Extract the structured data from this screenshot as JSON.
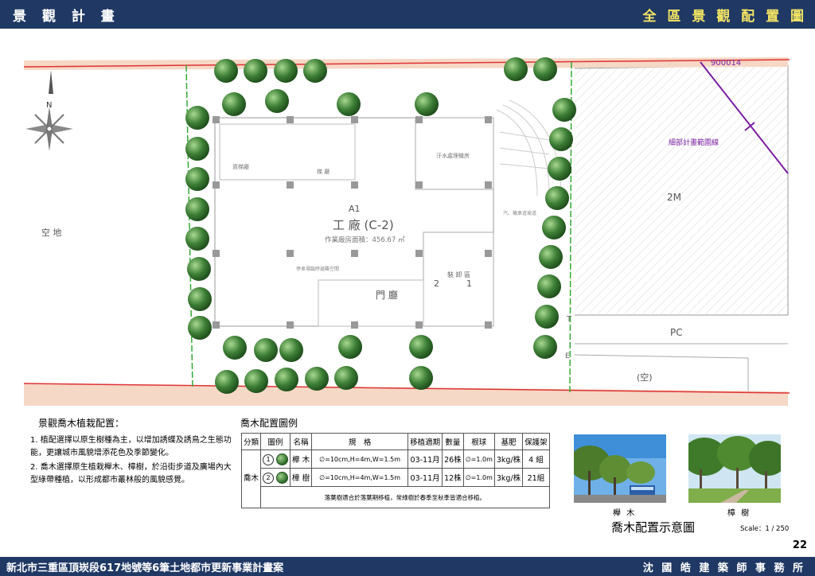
{
  "header": {
    "left": "景 觀 計 畫",
    "right": "全 區 景 觀 配 置 圖"
  },
  "footer": {
    "left": "新北市三重區頂崁段617地號等6筆土地都市更新事業計畫案",
    "right": "沈 國 皓 建 築 師 事 務 所"
  },
  "page_number": "22",
  "plan": {
    "north": "N",
    "empty_lot": "空 地",
    "area_2m": "2M",
    "area_pc": "PC",
    "area_empty": "(空)",
    "boundary_label": "細部計畫範圍線",
    "code_top": "900014",
    "block": "A1",
    "factory": "工 廠 (C-2)",
    "factory_area": "作業廠房面積：456.67 ㎡",
    "lobby": "門 廳",
    "unload": "裝 卸 區",
    "num1": "1",
    "num2": "2",
    "wastewater": "汙水處理機房",
    "storage": "貨梯廳",
    "stairs": "梯 廳",
    "shelter": "停車場臨時避難空間",
    "ramp": "汽、機車道坡道",
    "t_mark": "T",
    "e_mark": "E"
  },
  "notes": {
    "title": "景觀喬木植栽配置：",
    "items": [
      "1. 植配選擇以原生樹種為主，以增加誘蝶及誘鳥之生態功能，更讓城市風貌增添花色及季節變化。",
      "2. 喬木選擇原生植栽櫸木、樟樹，於沿街步道及廣場內大型綠帶種植，以形成都市叢林般的風貌感覺。"
    ]
  },
  "legend": {
    "title": "喬木配置圖例",
    "headers": [
      "分類",
      "圖例",
      "名稱",
      "規　格",
      "移植適期",
      "數量",
      "根球",
      "基肥",
      "保護架"
    ],
    "category": "喬木",
    "rows": [
      {
        "num": "1",
        "name": "櫸 木",
        "spec": "∅=10cm,H=4m,W=1.5m",
        "period": "03-11月",
        "qty": "26株",
        "root": "∅=1.0m",
        "fert": "3kg/株",
        "guard": "4 組"
      },
      {
        "num": "2",
        "name": "樟 樹",
        "spec": "∅=10cm,H=4m,W=1.5m",
        "period": "03-11月",
        "qty": "12株",
        "root": "∅=1.0m",
        "fert": "3kg/株",
        "guard": "21組"
      }
    ],
    "note": "落葉樹適合於落葉期移植，常綠樹於春季至秋季皆適合移植。"
  },
  "photos": {
    "zelkova": "櫸 木",
    "camphor": "樟 樹"
  },
  "diagram_title": "喬木配置示意圖",
  "scale": "Scale：1 / 250"
}
